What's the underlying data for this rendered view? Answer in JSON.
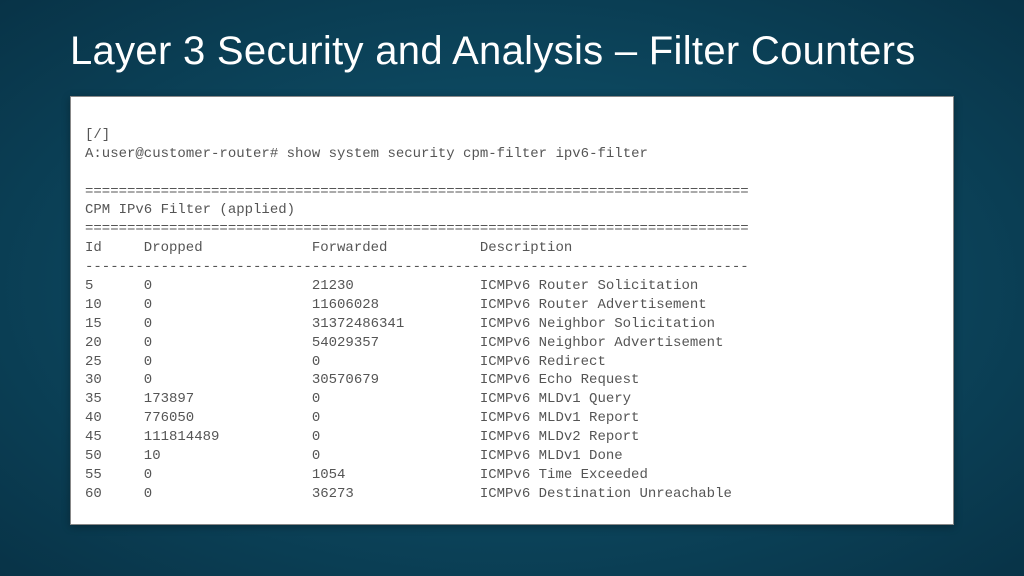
{
  "slide": {
    "title": "Layer 3 Security and Analysis – Filter Counters"
  },
  "terminal": {
    "cwd": "[/]",
    "prompt": "A:user@customer-router# show system security cpm-filter ipv6-filter",
    "rule1": "===============================================================================",
    "heading": "CPM IPv6 Filter (applied)",
    "rule2": "===============================================================================",
    "cols": {
      "c1": "Id",
      "c2": "Dropped",
      "c3": "Forwarded",
      "c4": "Description"
    },
    "rule3": "-------------------------------------------------------------------------------",
    "rows": [
      {
        "id": "5",
        "dropped": "0",
        "forwarded": "21230",
        "desc": "ICMPv6 Router Solicitation"
      },
      {
        "id": "10",
        "dropped": "0",
        "forwarded": "11606028",
        "desc": "ICMPv6 Router Advertisement"
      },
      {
        "id": "15",
        "dropped": "0",
        "forwarded": "31372486341",
        "desc": "ICMPv6 Neighbor Solicitation"
      },
      {
        "id": "20",
        "dropped": "0",
        "forwarded": "54029357",
        "desc": "ICMPv6 Neighbor Advertisement"
      },
      {
        "id": "25",
        "dropped": "0",
        "forwarded": "0",
        "desc": "ICMPv6 Redirect"
      },
      {
        "id": "30",
        "dropped": "0",
        "forwarded": "30570679",
        "desc": "ICMPv6 Echo Request"
      },
      {
        "id": "35",
        "dropped": "173897",
        "forwarded": "0",
        "desc": "ICMPv6 MLDv1 Query"
      },
      {
        "id": "40",
        "dropped": "776050",
        "forwarded": "0",
        "desc": "ICMPv6 MLDv1 Report"
      },
      {
        "id": "45",
        "dropped": "111814489",
        "forwarded": "0",
        "desc": "ICMPv6 MLDv2 Report"
      },
      {
        "id": "50",
        "dropped": "10",
        "forwarded": "0",
        "desc": "ICMPv6 MLDv1 Done"
      },
      {
        "id": "55",
        "dropped": "0",
        "forwarded": "1054",
        "desc": "ICMPv6 Time Exceeded"
      },
      {
        "id": "60",
        "dropped": "0",
        "forwarded": "36273",
        "desc": "ICMPv6 Destination Unreachable"
      }
    ]
  }
}
